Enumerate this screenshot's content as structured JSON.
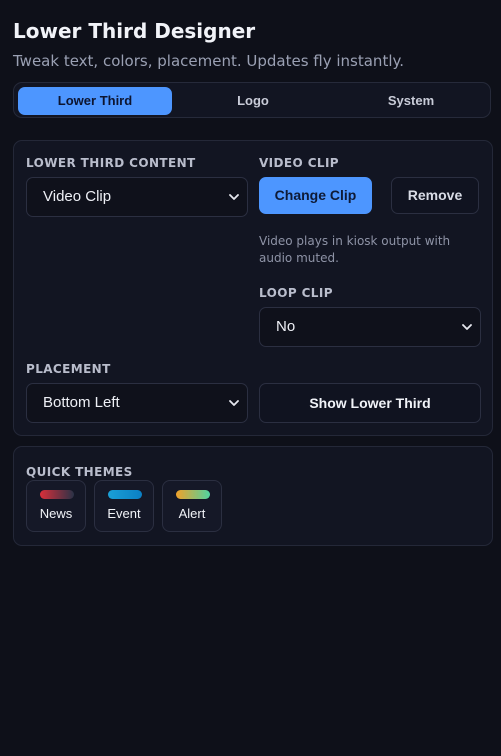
{
  "header": {
    "title": "Lower Third Designer",
    "subtitle": "Tweak text, colors, placement. Updates fly instantly."
  },
  "tabs": [
    {
      "label": "Lower Third",
      "active": true
    },
    {
      "label": "Logo",
      "active": false
    },
    {
      "label": "System",
      "active": false
    }
  ],
  "content": {
    "section_label": "LOWER THIRD CONTENT",
    "selected": "Video Clip"
  },
  "video_clip": {
    "section_label": "VIDEO CLIP",
    "change_label": "Change Clip",
    "remove_label": "Remove",
    "hint": "Video plays in kiosk output with audio muted."
  },
  "loop_clip": {
    "section_label": "LOOP CLIP",
    "selected": "No"
  },
  "placement": {
    "section_label": "PLACEMENT",
    "selected": "Bottom Left",
    "show_label": "Show Lower Third"
  },
  "quick_themes": {
    "section_label": "QUICK THEMES",
    "themes": [
      {
        "label": "News",
        "swatch_from": "#d92f3a",
        "swatch_to": "#2a3247"
      },
      {
        "label": "Event",
        "swatch_from": "#1a9fd6",
        "swatch_to": "#0b7fc4"
      },
      {
        "label": "Alert",
        "swatch_from": "#f0a12a",
        "swatch_to": "#4fd3a0"
      }
    ]
  },
  "colors": {
    "accent": "#4d96ff",
    "background": "#0e1019",
    "card": "#121522"
  }
}
